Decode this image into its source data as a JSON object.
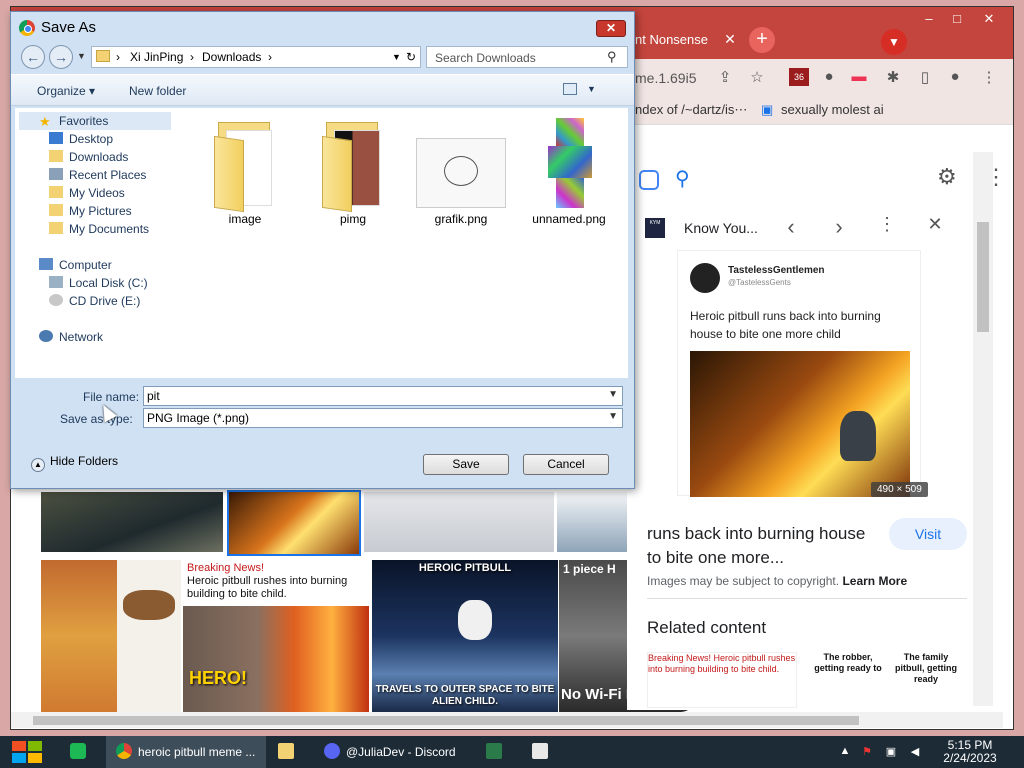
{
  "chrome": {
    "tab_title": "nt Nonsense",
    "url_fragment": "me.1.69i5",
    "ext_badge": "36",
    "bookmarks": [
      "ndex of /~dartz/is⋯",
      "sexually molest ai"
    ],
    "window_controls": [
      "–",
      "□",
      "✕"
    ]
  },
  "panel": {
    "title": "Know You...",
    "tweet_name": "TastelessGentlemen",
    "tweet_handle": "@TastelessGents",
    "tweet_text": "Heroic pitbull runs back into burning house to bite one more child",
    "image_dims": "490 × 509",
    "caption": "runs back into burning house to bite one more...",
    "visit_label": "Visit",
    "copyright_text": "Images may be subject to copyright.",
    "learn_more": "Learn More",
    "related_title": "Related content",
    "related": [
      {
        "text": "Breaking News!\nHeroic pitbull rushes into burning building to bite child."
      },
      {
        "text": "The robber, getting ready to"
      },
      {
        "text": "The family pitbull, getting ready"
      }
    ]
  },
  "grid": {
    "breaking_news": "Breaking News!",
    "breaking_text": "Heroic pitbull rushes into burning building to bite child.",
    "hero_text": "HERO!",
    "heroic_pitbull": "HEROIC PITBULL",
    "travels_text": "TRAVELS TO OUTER SPACE TO BITE ALIEN CHILD.",
    "one_piece": "1 piece H",
    "no_wifi": "No Wi-Fi Neede"
  },
  "dialog": {
    "title": "Save As",
    "close": "✕",
    "breadcrumb": [
      "Xi JinPing",
      "Downloads"
    ],
    "search_placeholder": "Search Downloads",
    "organize": "Organize",
    "new_folder": "New folder",
    "nav": {
      "favorites": "Favorites",
      "desktop": "Desktop",
      "downloads": "Downloads",
      "recent": "Recent Places",
      "videos": "My Videos",
      "pictures": "My Pictures",
      "documents": "My Documents",
      "computer": "Computer",
      "local_disk": "Local Disk (C:)",
      "cd_drive": "CD Drive (E:)",
      "network": "Network"
    },
    "files": [
      {
        "name": "image",
        "kind": "folder"
      },
      {
        "name": "pimg",
        "kind": "folder"
      },
      {
        "name": "grafik.png",
        "kind": "image"
      },
      {
        "name": "unnamed.png",
        "kind": "image"
      }
    ],
    "file_name_label": "File name:",
    "file_name_value": "pit",
    "save_type_label": "Save as type:",
    "save_type_value": "PNG Image (*.png)",
    "hide_folders": "Hide Folders",
    "save_label": "Save",
    "cancel_label": "Cancel"
  },
  "taskbar": {
    "chrome_item": "heroic pitbull meme ...",
    "discord_item": "@JuliaDev - Discord",
    "time": "5:15 PM",
    "date": "2/24/2023"
  }
}
